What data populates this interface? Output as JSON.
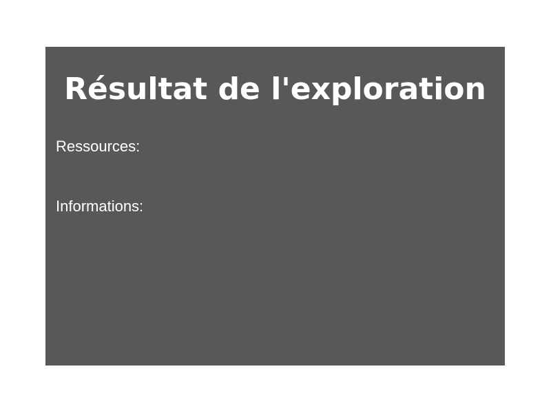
{
  "dialog": {
    "title": "Résultat de l'exploration",
    "background_color": "#585858",
    "text_color": "#ffffff",
    "sections": {
      "resources": {
        "label": "Ressources:"
      },
      "informations": {
        "label": "Informations:"
      }
    }
  }
}
